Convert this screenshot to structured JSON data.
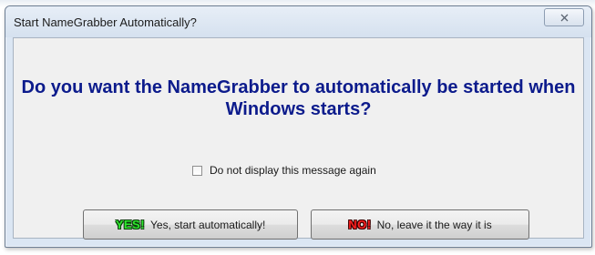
{
  "window": {
    "title": "Start NameGrabber Automatically?",
    "close_icon": "close-x-icon"
  },
  "dialog": {
    "question": "Do you want the NameGrabber to automatically be started when Windows starts?",
    "checkbox_label": "Do not display this message again",
    "checkbox_checked": false
  },
  "buttons": {
    "yes_badge": "YES!",
    "yes_label": "Yes, start automatically!",
    "no_badge": "NO!",
    "no_label": "No, leave it the way it is"
  },
  "colors": {
    "question_text": "#0c1b8c",
    "yes_badge": "#2ee62e",
    "no_badge": "#ff2020",
    "frame": "#dbe6f3"
  }
}
